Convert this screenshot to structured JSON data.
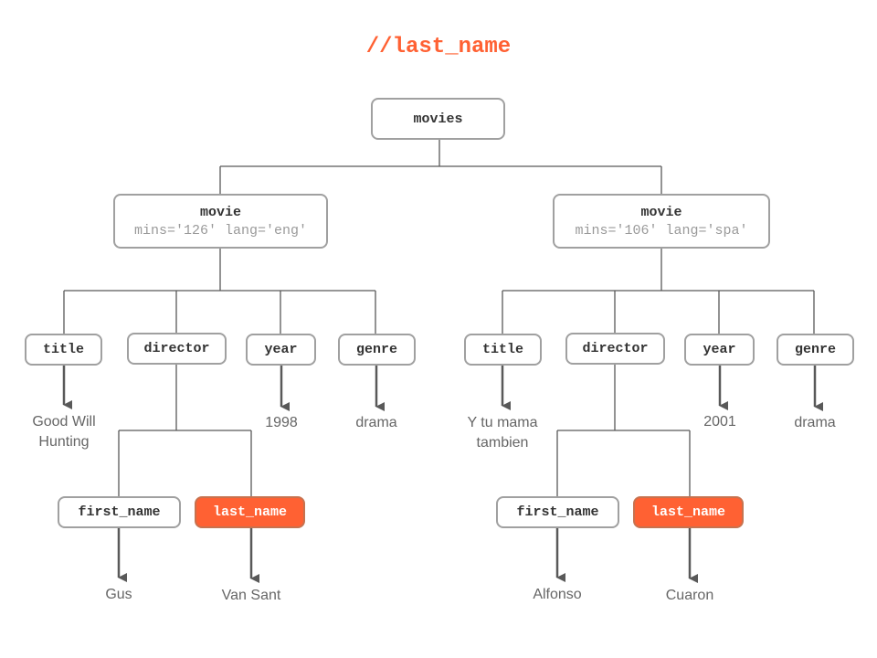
{
  "query": "//last_name",
  "colors": {
    "highlight": "#ff6133",
    "edge": "#595959",
    "node_border": "#a0a0a0"
  },
  "tree": {
    "root": "movies",
    "movies": [
      {
        "tag": "movie",
        "attrs": "mins='126' lang='eng'",
        "title": {
          "tag": "title",
          "value": "Good Will\nHunting"
        },
        "director": {
          "tag": "director",
          "first_name": {
            "tag": "first_name",
            "value": "Gus",
            "highlighted": false
          },
          "last_name": {
            "tag": "last_name",
            "value": "Van Sant",
            "highlighted": true
          }
        },
        "year": {
          "tag": "year",
          "value": "1998"
        },
        "genre": {
          "tag": "genre",
          "value": "drama"
        }
      },
      {
        "tag": "movie",
        "attrs": "mins='106' lang='spa'",
        "title": {
          "tag": "title",
          "value": "Y tu mama\ntambien"
        },
        "director": {
          "tag": "director",
          "first_name": {
            "tag": "first_name",
            "value": "Alfonso",
            "highlighted": false
          },
          "last_name": {
            "tag": "last_name",
            "value": "Cuaron",
            "highlighted": true
          }
        },
        "year": {
          "tag": "year",
          "value": "2001"
        },
        "genre": {
          "tag": "genre",
          "value": "drama"
        }
      }
    ]
  }
}
